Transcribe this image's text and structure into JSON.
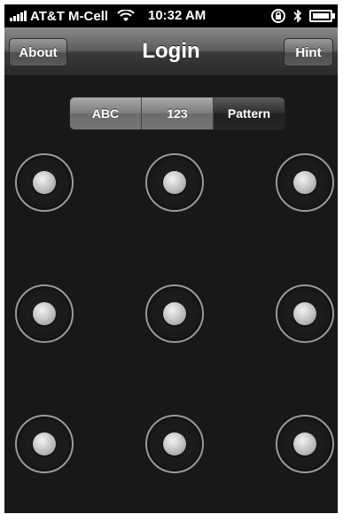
{
  "status_bar": {
    "carrier": "AT&T M-Cell",
    "time": "10:32 AM",
    "icons": [
      "signal-icon",
      "wifi-icon",
      "rotation-lock-icon",
      "bluetooth-icon",
      "battery-icon"
    ]
  },
  "nav_bar": {
    "title": "Login",
    "left_button": "About",
    "right_button": "Hint"
  },
  "segmented_control": {
    "segments": [
      "ABC",
      "123",
      "Pattern"
    ],
    "selected": "Pattern"
  },
  "pattern_grid": {
    "rows": 3,
    "columns": 3,
    "dots": [
      "dot-1",
      "dot-2",
      "dot-3",
      "dot-4",
      "dot-5",
      "dot-6",
      "dot-7",
      "dot-8",
      "dot-9"
    ]
  },
  "colors": {
    "background": "#181818",
    "ring": "#9a9a9a",
    "dot": "#c8c8c8"
  }
}
